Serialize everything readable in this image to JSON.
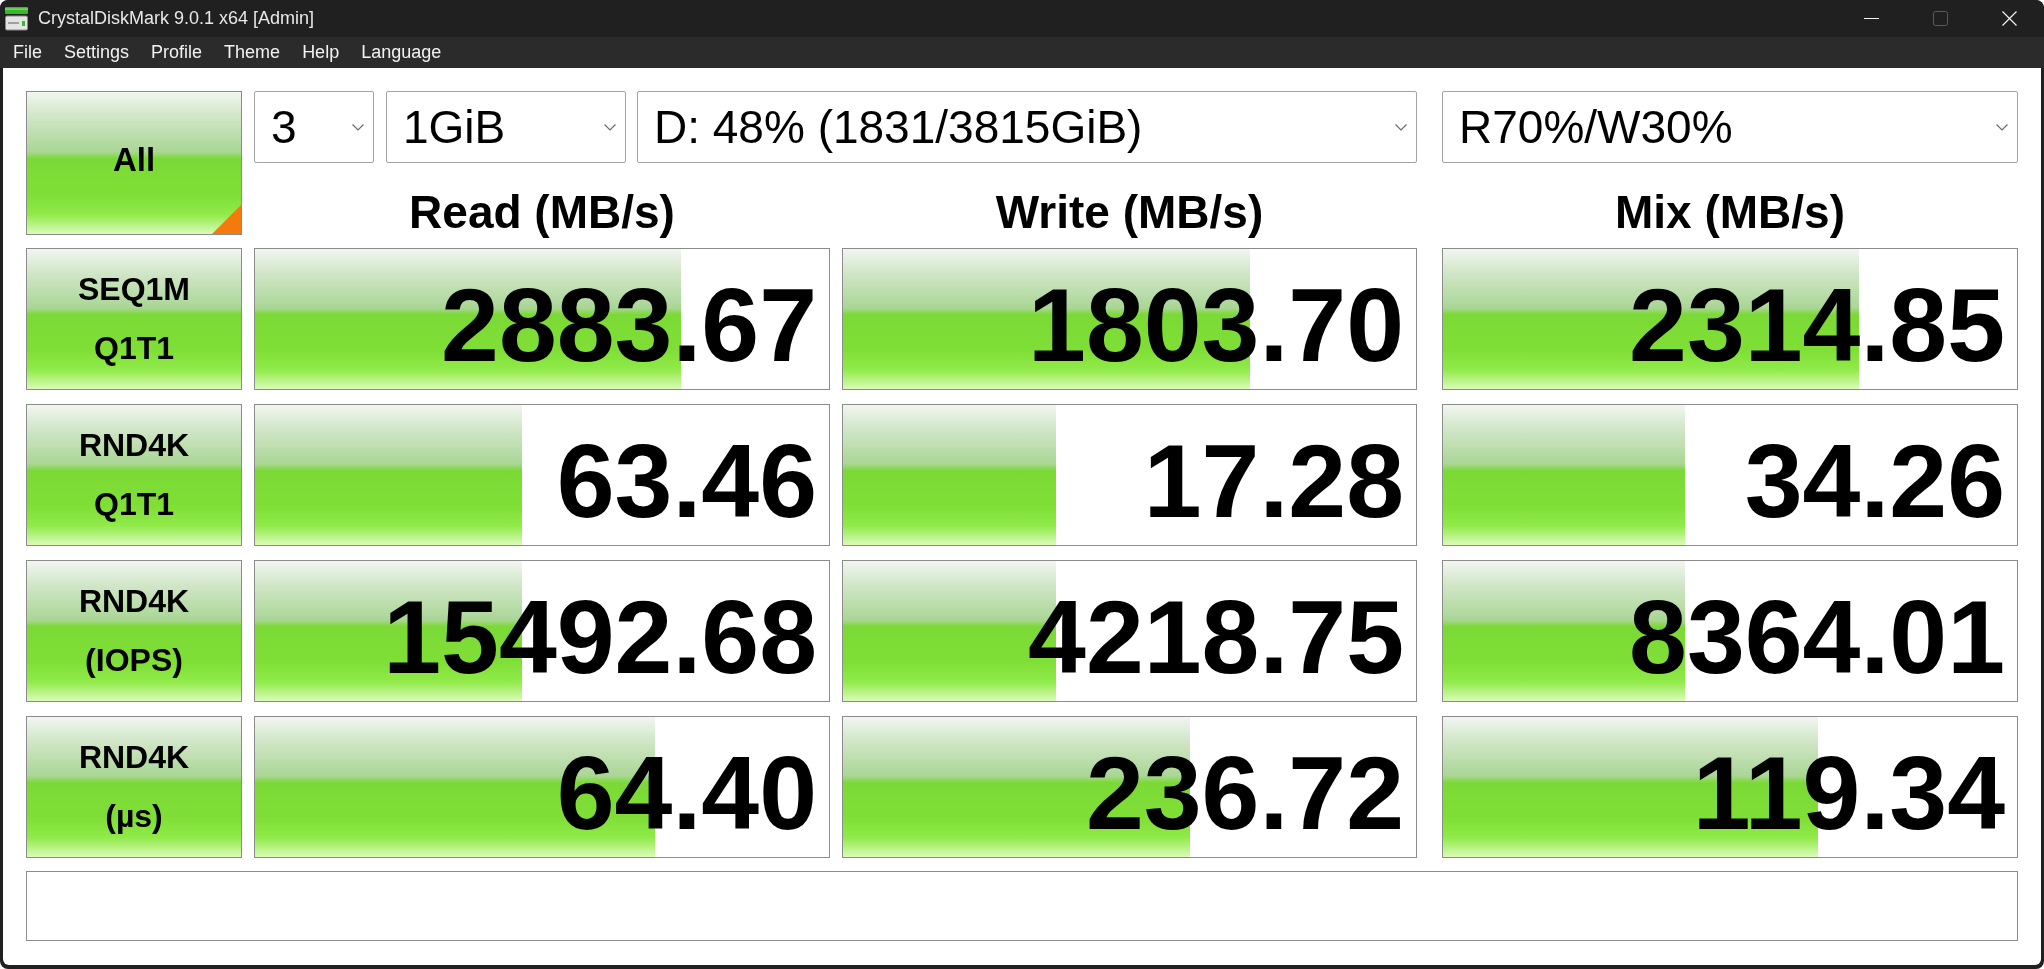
{
  "window": {
    "title": "CrystalDiskMark 9.0.1 x64 [Admin]",
    "controls": [
      {
        "kind": "minimize",
        "disabled": false
      },
      {
        "kind": "maximize",
        "disabled": true
      },
      {
        "kind": "close",
        "disabled": false
      }
    ]
  },
  "menu": [
    "File",
    "Settings",
    "Profile",
    "Theme",
    "Help",
    "Language"
  ],
  "all_button": {
    "label": "All"
  },
  "dropdowns": [
    {
      "value": "3"
    },
    {
      "value": "1GiB"
    },
    {
      "value": "D: 48% (1831/3815GiB)"
    },
    {
      "value": "R70%/W30%"
    }
  ],
  "columns": [
    "Read (MB/s)",
    "Write (MB/s)",
    "Mix (MB/s)"
  ],
  "rows": [
    {
      "label": [
        "SEQ1M",
        "Q1T1"
      ],
      "results": [
        {
          "value": "2883.67",
          "level": 0.742
        },
        {
          "value": "1803.70",
          "level": 0.71
        },
        {
          "value": "2314.85",
          "level": 0.724
        }
      ]
    },
    {
      "label": [
        "RND4K",
        "Q1T1"
      ],
      "results": [
        {
          "value": "63.46",
          "level": 0.466
        },
        {
          "value": "17.28",
          "level": 0.372
        },
        {
          "value": "34.26",
          "level": 0.421
        }
      ]
    },
    {
      "label": [
        "RND4K",
        "(IOPS)"
      ],
      "results": [
        {
          "value": "15492.68",
          "level": 0.466
        },
        {
          "value": "4218.75",
          "level": 0.372
        },
        {
          "value": "8364.01",
          "level": 0.421
        }
      ]
    },
    {
      "label": [
        "RND4K",
        "(µs)"
      ],
      "results": [
        {
          "value": "64.40",
          "level": 0.697
        },
        {
          "value": "236.72",
          "level": 0.605
        },
        {
          "value": "119.34",
          "level": 0.654
        }
      ]
    }
  ]
}
